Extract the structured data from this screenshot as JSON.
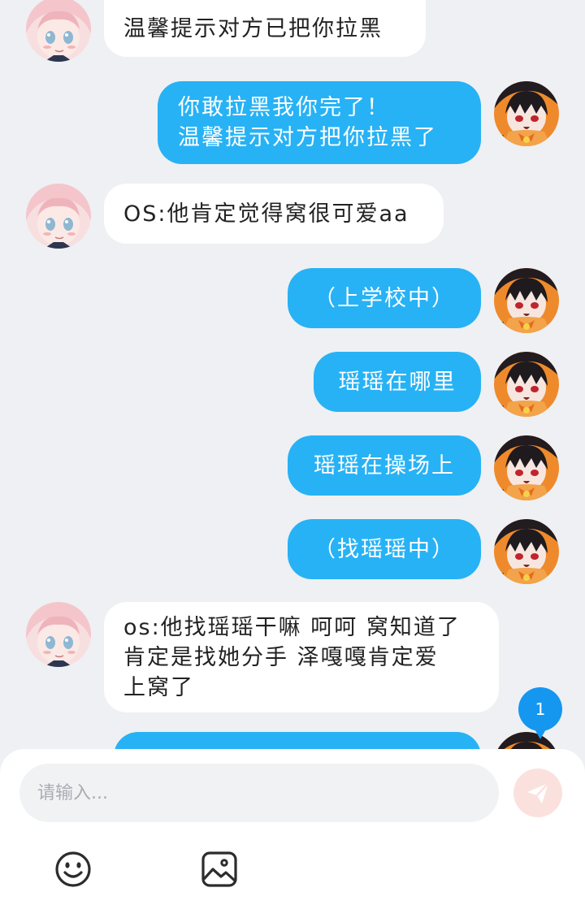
{
  "avatars": {
    "other": {
      "name": "pink-hair-anime-avatar",
      "hair": "#f4c6cb",
      "skin": "#fbe9e6",
      "eyes": "#8fb7d2"
    },
    "me": {
      "name": "black-hair-anime-avatar",
      "hair": "#1f1a1e",
      "bg": "#ee8a2c",
      "eyes": "#c0242c"
    }
  },
  "messages": [
    {
      "side": "in",
      "text": "温馨提示对方已把你拉黑"
    },
    {
      "side": "out",
      "text": "你敢拉黑我你完了！\n温馨提示对方把你拉黑了"
    },
    {
      "side": "in",
      "text": "OS:他肯定觉得窝很可爱aa"
    },
    {
      "side": "out",
      "text": "（上学校中）"
    },
    {
      "side": "out",
      "text": "瑶瑶在哪里"
    },
    {
      "side": "out",
      "text": "瑶瑶在操场上"
    },
    {
      "side": "out",
      "text": "（找瑶瑶中）"
    },
    {
      "side": "in",
      "text": "os:他找瑶瑶干嘛 呵呵 窝知道了\n肯定是找她分手 泽嘎嘎肯定爱\n上窝了"
    },
    {
      "side": "out",
      "text": ""
    }
  ],
  "unread_count": "1",
  "composer": {
    "placeholder": "请输入...",
    "send_icon": "send-plane-icon",
    "emoji_icon": "smiley-face-icon",
    "image_icon": "image-picture-icon"
  },
  "colors": {
    "background": "#eef0f3",
    "outgoing_bubble": "#27b2f5",
    "incoming_bubble": "#ffffff",
    "badge": "#1597f0",
    "send_button": "#fbe1dd"
  }
}
